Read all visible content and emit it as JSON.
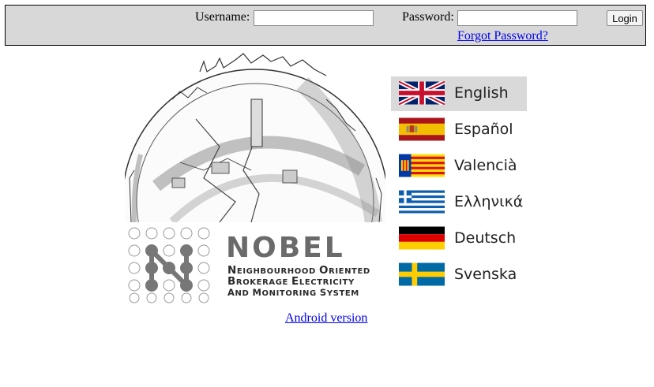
{
  "login": {
    "username_label": "Username:",
    "username_value": "",
    "password_label": "Password:",
    "password_value": "",
    "login_button": "Login",
    "forgot_link": "Forgot Password?"
  },
  "logo": {
    "title": "NOBEL",
    "subtitle_lines": [
      "Neighbourhood Oriented",
      "Brokerage Electricity",
      "and monitoring system"
    ]
  },
  "android_link": "Android version",
  "languages": [
    {
      "label": "English",
      "flag": "uk-flag-icon",
      "selected": true
    },
    {
      "label": "Español",
      "flag": "spain-flag-icon",
      "selected": false
    },
    {
      "label": "Valencià",
      "flag": "valencia-flag-icon",
      "selected": false
    },
    {
      "label": "Ελληνικά",
      "flag": "greece-flag-icon",
      "selected": false
    },
    {
      "label": "Deutsch",
      "flag": "germany-flag-icon",
      "selected": false
    },
    {
      "label": "Svenska",
      "flag": "sweden-flag-icon",
      "selected": false
    }
  ],
  "colors": {
    "link": "#0000ee",
    "bar_background": "#d8d8d8",
    "selected_language_background": "#d9d9d9"
  }
}
